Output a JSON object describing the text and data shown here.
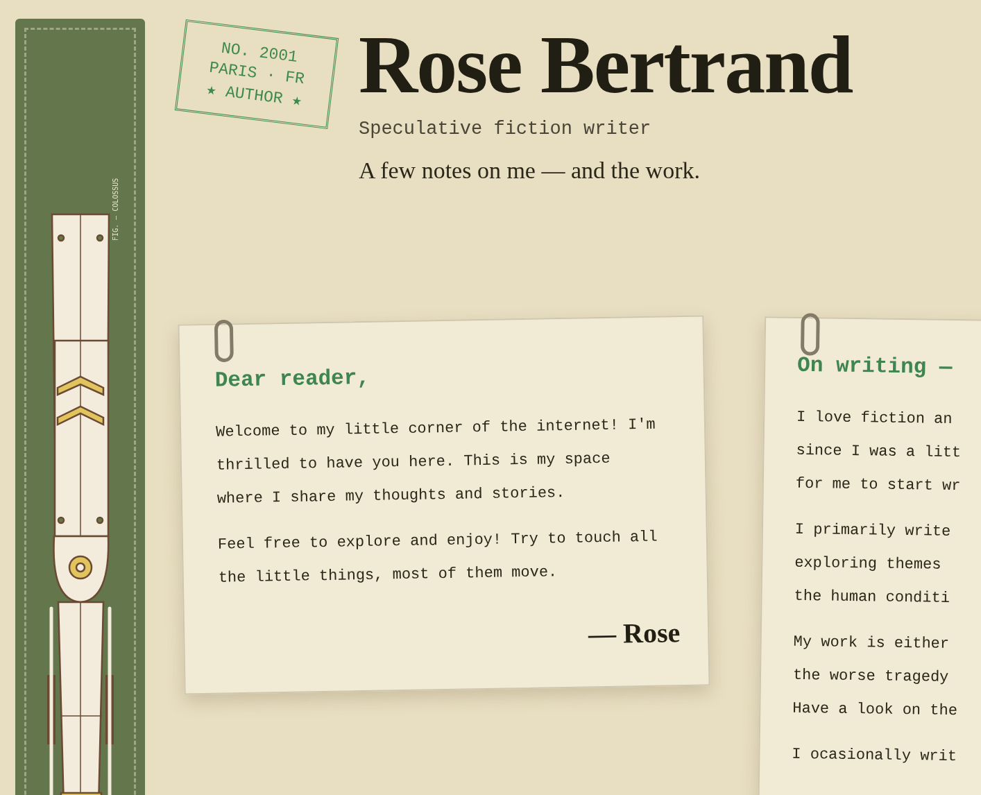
{
  "sidebar": {
    "figure_caption": "FIG. — COLOSSUS"
  },
  "stamp": {
    "lines": [
      "NO. 2001",
      "PARIS · FR",
      "★ AUTHOR ★"
    ]
  },
  "header": {
    "title": "Rose Bertrand",
    "subtitle": "Speculative fiction writer",
    "tagline": "A few notes on me — and the work."
  },
  "cards": [
    {
      "heading": "Dear reader,",
      "paragraphs": [
        [
          "Welcome to my little corner of the internet! I'm",
          "thrilled to have you here. This is my space",
          "where I share my thoughts and stories."
        ],
        [
          "Feel free to explore and enjoy! Try to touch all",
          "the little things, most of them move."
        ]
      ],
      "signature": "— Rose"
    },
    {
      "heading": "On writing —",
      "paragraphs": [
        [
          "I love fiction an",
          "since I was a litt",
          "for me to start wr"
        ],
        [
          "I primarily write",
          "exploring themes",
          "the human conditi"
        ],
        [
          "My work is either",
          "the worse tragedy",
          "Have a look on the"
        ],
        [
          "I ocasionally writ"
        ]
      ]
    }
  ]
}
